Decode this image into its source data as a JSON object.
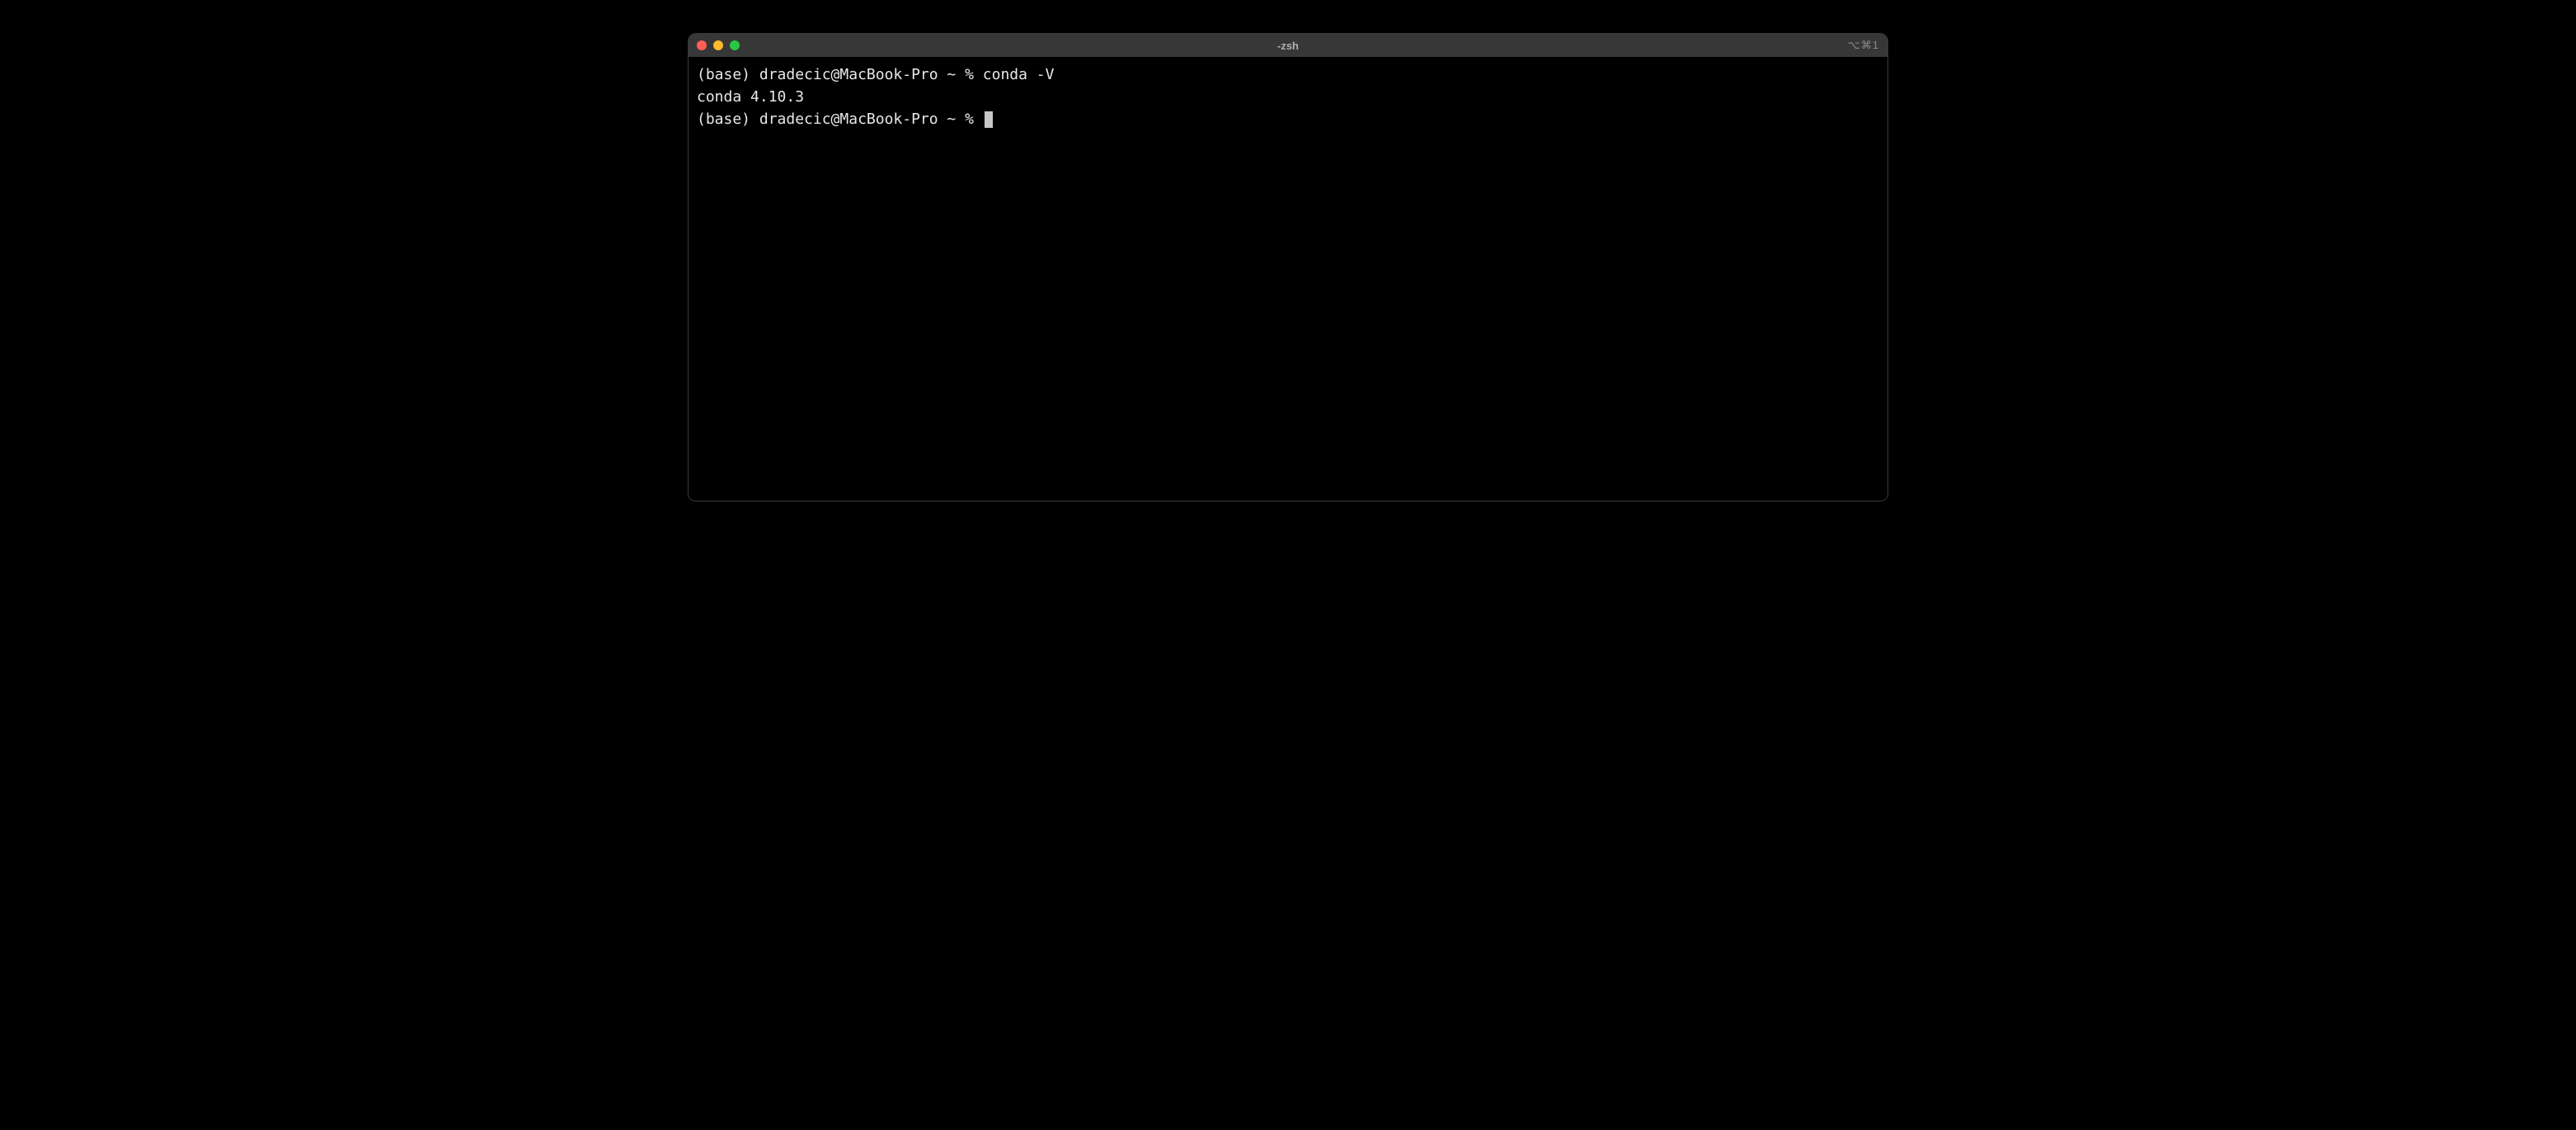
{
  "window": {
    "title": "-zsh",
    "shortcut": "⌥⌘1"
  },
  "colors": {
    "close": "#ff5f57",
    "minimize": "#febc2e",
    "maximize": "#28c840"
  },
  "terminal": {
    "lines": [
      {
        "prompt": "(base) dradecic@MacBook-Pro ~ % ",
        "command": "conda -V"
      },
      {
        "output": "conda 4.10.3"
      },
      {
        "prompt": "(base) dradecic@MacBook-Pro ~ % ",
        "command": ""
      }
    ]
  }
}
